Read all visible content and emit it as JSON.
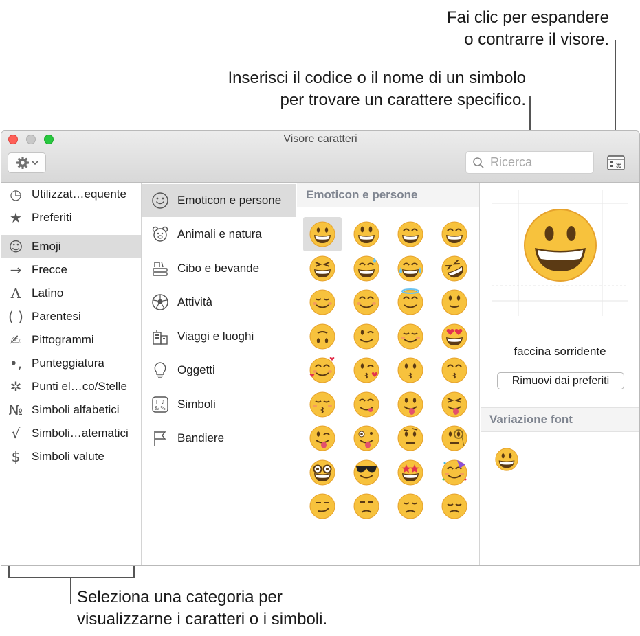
{
  "callouts": {
    "expand_line1": "Fai clic per espandere",
    "expand_line2": "o contrarre il visore.",
    "search_line1": "Inserisci il codice o il nome di un simbolo",
    "search_line2": "per trovare un carattere specifico.",
    "category_line1": "Seleziona una categoria per",
    "category_line2": "visualizzarne i caratteri o i simboli."
  },
  "window": {
    "title": "Visore caratteri",
    "search_placeholder": "Ricerca"
  },
  "categories": [
    {
      "label": "Utilizzat…equente",
      "icon": "clock-icon",
      "glyph": "◷"
    },
    {
      "label": "Preferiti",
      "icon": "star-icon",
      "glyph": "★"
    },
    {
      "label": "Emoji",
      "icon": "smiley-icon",
      "glyph": "☺",
      "selected": true
    },
    {
      "label": "Frecce",
      "icon": "arrow-icon",
      "glyph": "→"
    },
    {
      "label": "Latino",
      "icon": "latin-a-icon",
      "glyph": "A"
    },
    {
      "label": "Parentesi",
      "icon": "parentheses-icon",
      "glyph": "( )"
    },
    {
      "label": "Pittogrammi",
      "icon": "pictograph-icon",
      "glyph": "✍"
    },
    {
      "label": "Punteggiatura",
      "icon": "punctuation-icon",
      "glyph": "•,"
    },
    {
      "label": "Punti el…co/Stelle",
      "icon": "asterisk-icon",
      "glyph": "✲"
    },
    {
      "label": "Simboli alfabetici",
      "icon": "numero-icon",
      "glyph": "№"
    },
    {
      "label": "Simboli…atematici",
      "icon": "sqrt-icon",
      "glyph": "√"
    },
    {
      "label": "Simboli valute",
      "icon": "dollar-icon",
      "glyph": "$"
    }
  ],
  "subcategories": [
    {
      "label": "Emoticon e persone",
      "icon": "smiley-face-icon",
      "selected": true
    },
    {
      "label": "Animali e natura",
      "icon": "bear-icon"
    },
    {
      "label": "Cibo e bevande",
      "icon": "food-icon"
    },
    {
      "label": "Attività",
      "icon": "soccer-ball-icon"
    },
    {
      "label": "Viaggi e luoghi",
      "icon": "building-icon"
    },
    {
      "label": "Oggetti",
      "icon": "lightbulb-icon"
    },
    {
      "label": "Simboli",
      "icon": "symbols-icon"
    },
    {
      "label": "Bandiere",
      "icon": "flag-icon"
    }
  ],
  "grid": {
    "header": "Emoticon e persone",
    "emojis": [
      "grinning-face-icon",
      "grinning-big-eyes-icon",
      "grinning-smiling-eyes-icon",
      "beaming-face-icon",
      "squinting-laughing-icon",
      "grinning-sweat-icon",
      "tears-of-joy-icon",
      "rolling-laughing-icon",
      "smiling-face-icon",
      "smiling-eyes-icon",
      "halo-face-icon",
      "slight-smile-icon",
      "upside-down-face-icon",
      "winking-face-icon",
      "relieved-face-icon",
      "heart-eyes-icon",
      "smiling-hearts-icon",
      "kissing-heart-icon",
      "kissing-face-icon",
      "kissing-smiling-eyes-icon",
      "kissing-closed-eyes-icon",
      "yum-face-icon",
      "tongue-out-icon",
      "squinting-tongue-icon",
      "winking-tongue-icon",
      "zany-face-icon",
      "raised-eyebrow-icon",
      "monocle-face-icon",
      "nerd-face-icon",
      "sunglasses-face-icon",
      "star-struck-icon",
      "partying-face-icon",
      "smirking-face-icon",
      "unamused-face-icon",
      "disappointed-face-icon",
      "pensive-face-icon"
    ]
  },
  "detail": {
    "glyph_name": "faccina sorridente",
    "favorites_button": "Rimuovi dai preferiti",
    "variation_header": "Variazione font"
  }
}
